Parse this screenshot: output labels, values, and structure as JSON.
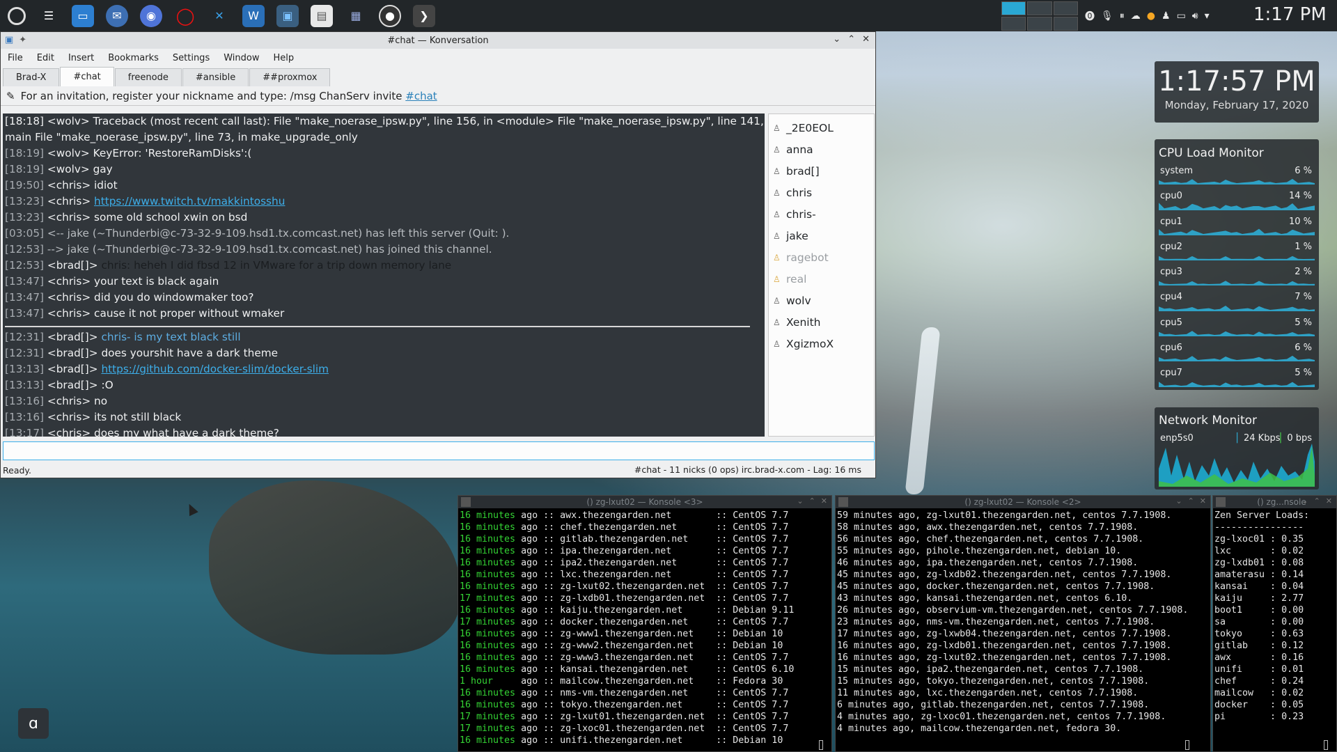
{
  "taskbar": {
    "clock": "1:17 PM",
    "icons": [
      "settings-icon",
      "launcher-icon",
      "files-icon",
      "mail-icon",
      "chromium-icon",
      "opera-icon",
      "vscode-icon",
      "writer-icon",
      "konversation-icon",
      "document-icon",
      "network-icon",
      "obs-icon",
      "terminal-icon"
    ]
  },
  "konversation": {
    "title": "#chat — Konversation",
    "menu": [
      "File",
      "Edit",
      "Insert",
      "Bookmarks",
      "Settings",
      "Window",
      "Help"
    ],
    "tabs": [
      "Brad-X",
      "#chat",
      "freenode",
      "#ansible",
      "##proxmox"
    ],
    "active_tab": "#chat",
    "topic_text": "For an invitation, register your nickname and type: /msg ChanServ invite",
    "topic_link": "#chat",
    "chat_lines": [
      {
        "ts": "",
        "nick": "",
        "text": "",
        "style": "",
        "raw": "[18:18] <wolv> Traceback (most recent call last): File \"make_noerase_ipsw.py\", line 156, in <module> File \"make_noerase_ipsw.py\", line 141, in"
      },
      {
        "ts": "",
        "nick": "",
        "text": "",
        "style": "",
        "raw": "main File \"make_noerase_ipsw.py\", line 73, in make_upgrade_only"
      },
      {
        "ts": "[18:19]",
        "nick": "<wolv>",
        "text": "KeyError: 'RestoreRamDisks':(",
        "style": ""
      },
      {
        "ts": "[18:19]",
        "nick": "<wolv>",
        "text": "gay",
        "style": ""
      },
      {
        "ts": "[19:50]",
        "nick": "<chris>",
        "text": "idiot",
        "style": ""
      },
      {
        "ts": "[13:23]",
        "nick": "<chris>",
        "text": "https://www.twitch.tv/makkintosshu",
        "style": "link"
      },
      {
        "ts": "[13:23]",
        "nick": "<chris>",
        "text": "some old school xwin on bsd",
        "style": ""
      },
      {
        "ts": "[03:05]",
        "nick": "",
        "text": "<-- jake (~Thunderbi@c-73-32-9-109.hsd1.tx.comcast.net) has left this server (Quit: ).",
        "style": "sys"
      },
      {
        "ts": "[12:53]",
        "nick": "",
        "text": "--> jake (~Thunderbi@c-73-32-9-109.hsd1.tx.comcast.net) has joined this channel.",
        "style": "sys"
      },
      {
        "ts": "[12:53]",
        "nick": "<brad[]>",
        "text": "chris: heheh I did fbsd 12 in VMware for a trip down memory lane",
        "style": "dark"
      },
      {
        "ts": "[13:47]",
        "nick": "<chris>",
        "text": "your text is black again",
        "style": ""
      },
      {
        "ts": "[13:47]",
        "nick": "<chris>",
        "text": "did you do windowmaker too?",
        "style": ""
      },
      {
        "ts": "[13:47]",
        "nick": "<chris>",
        "text": "cause it not proper without wmaker",
        "style": ""
      }
    ],
    "chat_lines_after_marker": [
      {
        "ts": "[12:31]",
        "nick": "<brad[]>",
        "text": "chris- is my text black still",
        "style": "hl"
      },
      {
        "ts": "[12:31]",
        "nick": "<brad[]>",
        "text": "does yourshit have a dark theme",
        "style": ""
      },
      {
        "ts": "[13:13]",
        "nick": "<brad[]>",
        "text": "https://github.com/docker-slim/docker-slim",
        "style": "link"
      },
      {
        "ts": "[13:13]",
        "nick": "<brad[]>",
        "text": ":O",
        "style": ""
      },
      {
        "ts": "[13:16]",
        "nick": "<chris>",
        "text": "no",
        "style": ""
      },
      {
        "ts": "[13:16]",
        "nick": "<chris>",
        "text": "its not still black",
        "style": ""
      },
      {
        "ts": "[13:17]",
        "nick": "<chris>",
        "text": "does my what have a dark theme?",
        "style": ""
      }
    ],
    "nicks": [
      {
        "name": "_2E0EOL",
        "away": false
      },
      {
        "name": "anna",
        "away": false
      },
      {
        "name": "brad[]",
        "away": false
      },
      {
        "name": "chris",
        "away": false
      },
      {
        "name": "chris-",
        "away": false
      },
      {
        "name": "jake",
        "away": false
      },
      {
        "name": "ragebot",
        "away": true
      },
      {
        "name": "real",
        "away": true
      },
      {
        "name": "wolv",
        "away": false
      },
      {
        "name": "Xenith",
        "away": false
      },
      {
        "name": "XgizmoX",
        "away": false
      }
    ],
    "input_value": "",
    "status_left": "Ready.",
    "status_right": "#chat - 11 nicks (0 ops)  irc.brad-x.com - Lag: 16 ms"
  },
  "clock_widget": {
    "time": "1:17:57 PM",
    "date": "Monday, February 17, 2020"
  },
  "cpu_widget": {
    "title": "CPU Load Monitor",
    "rows": [
      {
        "name": "system",
        "value": "6 %"
      },
      {
        "name": "cpu0",
        "value": "14 %"
      },
      {
        "name": "cpu1",
        "value": "10 %"
      },
      {
        "name": "cpu2",
        "value": "1 %"
      },
      {
        "name": "cpu3",
        "value": "2 %"
      },
      {
        "name": "cpu4",
        "value": "7 %"
      },
      {
        "name": "cpu5",
        "value": "5 %"
      },
      {
        "name": "cpu6",
        "value": "6 %"
      },
      {
        "name": "cpu7",
        "value": "5 %"
      }
    ]
  },
  "net_widget": {
    "title": "Network Monitor",
    "iface": "enp5s0",
    "down": "24 Kbps",
    "up": "0 bps"
  },
  "konsole1": {
    "title": "() zg-lxut02 — Konsole <3>",
    "lines": [
      [
        "16 minutes",
        " ago :: awx.thezengarden.net        :: CentOS 7.7"
      ],
      [
        "16 minutes",
        " ago :: chef.thezengarden.net       :: CentOS 7.7"
      ],
      [
        "16 minutes",
        " ago :: gitlab.thezengarden.net     :: CentOS 7.7"
      ],
      [
        "16 minutes",
        " ago :: ipa.thezengarden.net        :: CentOS 7.7"
      ],
      [
        "16 minutes",
        " ago :: ipa2.thezengarden.net       :: CentOS 7.7"
      ],
      [
        "16 minutes",
        " ago :: lxc.thezengarden.net        :: CentOS 7.7"
      ],
      [
        "16 minutes",
        " ago :: zg-lxut02.thezengarden.net  :: CentOS 7.7"
      ],
      [
        "17 minutes",
        " ago :: zg-lxdb01.thezengarden.net  :: CentOS 7.7"
      ],
      [
        "16 minutes",
        " ago :: kaiju.thezengarden.net      :: Debian 9.11"
      ],
      [
        "17 minutes",
        " ago :: docker.thezengarden.net     :: CentOS 7.7"
      ],
      [
        "16 minutes",
        " ago :: zg-www1.thezengarden.net    :: Debian 10"
      ],
      [
        "16 minutes",
        " ago :: zg-www2.thezengarden.net    :: Debian 10"
      ],
      [
        "16 minutes",
        " ago :: zg-www3.thezengarden.net    :: CentOS 7.7"
      ],
      [
        "16 minutes",
        " ago :: kansai.thezengarden.net     :: CentOS 6.10"
      ],
      [
        "1 hour    ",
        " ago :: mailcow.thezengarden.net    :: Fedora 30"
      ],
      [
        "16 minutes",
        " ago :: nms-vm.thezengarden.net     :: CentOS 7.7"
      ],
      [
        "16 minutes",
        " ago :: tokyo.thezengarden.net      :: CentOS 7.7"
      ],
      [
        "17 minutes",
        " ago :: zg-lxut01.thezengarden.net  :: CentOS 7.7"
      ],
      [
        "17 minutes",
        " ago :: zg-lxoc01.thezengarden.net  :: CentOS 7.7"
      ],
      [
        "16 minutes",
        " ago :: unifi.thezengarden.net      :: Debian 10"
      ]
    ]
  },
  "konsole2": {
    "title": "() zg-lxut02 — Konsole <2>",
    "lines": [
      "59 minutes ago, zg-lxut01.thezengarden.net, centos 7.7.1908.",
      "58 minutes ago, awx.thezengarden.net, centos 7.7.1908.",
      "56 minutes ago, chef.thezengarden.net, centos 7.7.1908.",
      "55 minutes ago, pihole.thezengarden.net, debian 10.",
      "46 minutes ago, ipa.thezengarden.net, centos 7.7.1908.",
      "45 minutes ago, zg-lxdb02.thezengarden.net, centos 7.7.1908.",
      "45 minutes ago, docker.thezengarden.net, centos 7.7.1908.",
      "43 minutes ago, kansai.thezengarden.net, centos 6.10.",
      "26 minutes ago, observium-vm.thezengarden.net, centos 7.7.1908.",
      "23 minutes ago, nms-vm.thezengarden.net, centos 7.7.1908.",
      "17 minutes ago, zg-lxwb04.thezengarden.net, centos 7.7.1908.",
      "16 minutes ago, zg-lxdb01.thezengarden.net, centos 7.7.1908.",
      "16 minutes ago, zg-lxut02.thezengarden.net, centos 7.7.1908.",
      "15 minutes ago, ipa2.thezengarden.net, centos 7.7.1908.",
      "15 minutes ago, tokyo.thezengarden.net, centos 7.7.1908.",
      "11 minutes ago, lxc.thezengarden.net, centos 7.7.1908.",
      "6 minutes ago, gitlab.thezengarden.net, centos 7.7.1908.",
      "4 minutes ago, zg-lxoc01.thezengarden.net, centos 7.7.1908.",
      "4 minutes ago, mailcow.thezengarden.net, fedora 30."
    ]
  },
  "konsole3": {
    "title": "() zg...nsole",
    "lines": [
      "Zen Server Loads:",
      "----------------",
      "zg-lxoc01 : 0.35",
      "lxc       : 0.02",
      "zg-lxdb01 : 0.08",
      "amaterasu : 0.14",
      "kansai    : 0.04",
      "kaiju     : 2.77",
      "boot1     : 0.00",
      "sa        : 0.00",
      "tokyo     : 0.63",
      "gitlab    : 0.12",
      "awx       : 0.16",
      "unifi     : 0.01",
      "chef      : 0.24",
      "mailcow   : 0.02",
      "docker    : 0.05",
      "pi        : 0.23"
    ]
  }
}
